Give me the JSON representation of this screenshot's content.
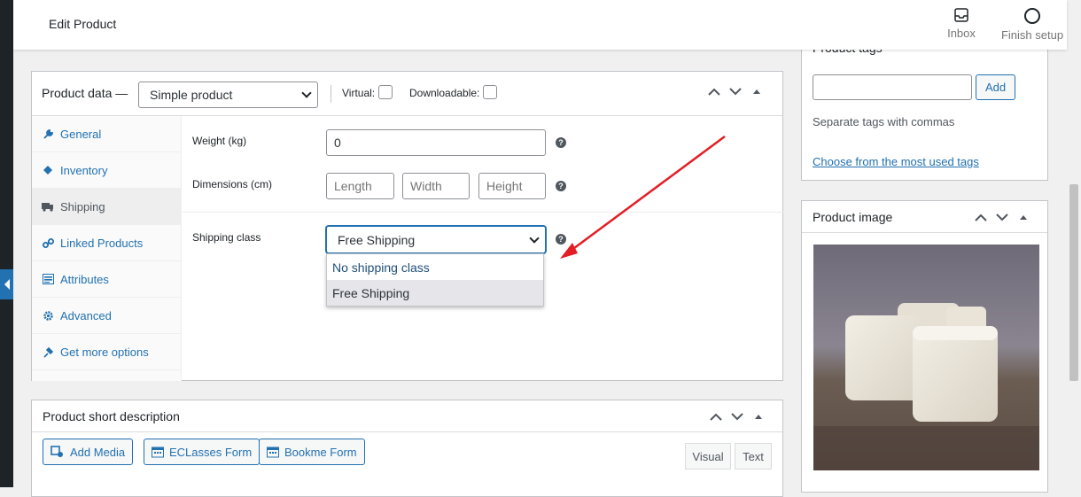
{
  "header": {
    "title": "Edit Product",
    "inbox_label": "Inbox",
    "finish_setup_label": "Finish setup"
  },
  "product_data": {
    "label": "Product data —",
    "product_type": "Simple product",
    "virtual_label": "Virtual:",
    "downloadable_label": "Downloadable:",
    "tabs": [
      {
        "label": "General",
        "icon": "wrench-icon"
      },
      {
        "label": "Inventory",
        "icon": "diamond-icon"
      },
      {
        "label": "Shipping",
        "icon": "truck-icon"
      },
      {
        "label": "Linked Products",
        "icon": "link-icon"
      },
      {
        "label": "Attributes",
        "icon": "list-icon"
      },
      {
        "label": "Advanced",
        "icon": "gear-icon"
      },
      {
        "label": "Get more options",
        "icon": "plugin-icon"
      }
    ],
    "active_tab": "Shipping",
    "weight_label": "Weight (kg)",
    "weight_value": "0",
    "dimensions_label": "Dimensions (cm)",
    "length_placeholder": "Length",
    "width_placeholder": "Width",
    "height_placeholder": "Height",
    "shipping_class_label": "Shipping class",
    "shipping_class_value": "Free Shipping",
    "shipping_class_options": [
      "No shipping class",
      "Free Shipping"
    ]
  },
  "short_description": {
    "title": "Product short description",
    "add_media_label": "Add Media",
    "eclasses_label": "ECLasses Form",
    "bookme_label": "Bookme Form",
    "visual_tab": "Visual",
    "text_tab": "Text"
  },
  "product_tags": {
    "title": "Product tags",
    "add_label": "Add",
    "note": "Separate tags with commas",
    "choose_link": "Choose from the most used tags"
  },
  "product_image": {
    "title": "Product image"
  },
  "colors": {
    "link": "#2271b1",
    "annotation_arrow": "#e31e24",
    "admin_bar": "#1d2327"
  }
}
